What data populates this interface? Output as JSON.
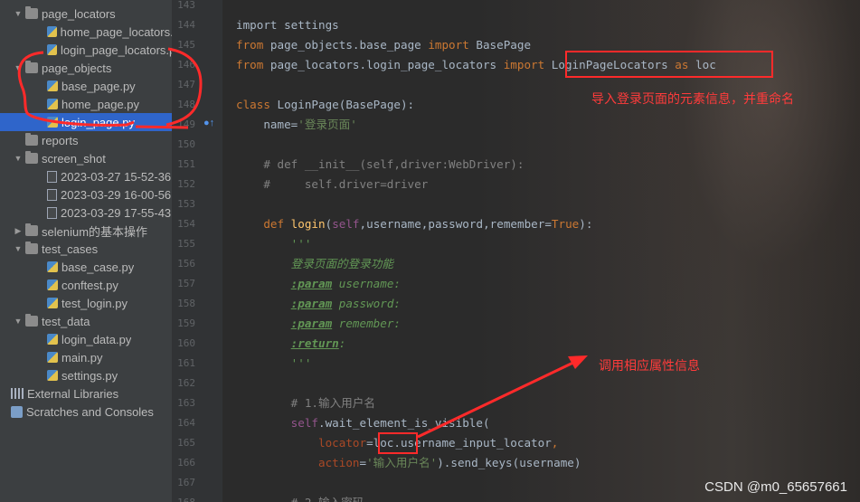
{
  "tree": [
    {
      "label": "page_locators",
      "type": "folder",
      "indent": 0,
      "open": true
    },
    {
      "label": "home_page_locators.py",
      "type": "py",
      "indent": 2
    },
    {
      "label": "login_page_locators.py",
      "type": "py",
      "indent": 2
    },
    {
      "label": "page_objects",
      "type": "folder",
      "indent": 0,
      "open": true
    },
    {
      "label": "base_page.py",
      "type": "py",
      "indent": 2
    },
    {
      "label": "home_page.py",
      "type": "py",
      "indent": 2
    },
    {
      "label": "login_page.py",
      "type": "py",
      "indent": 2,
      "selected": true
    },
    {
      "label": "reports",
      "type": "folder",
      "indent": 0,
      "open": false,
      "leaf": true
    },
    {
      "label": "screen_shot",
      "type": "folder",
      "indent": 0,
      "open": true
    },
    {
      "label": "2023-03-27 15-52-36",
      "type": "img",
      "indent": 2
    },
    {
      "label": "2023-03-29 16-00-56",
      "type": "img",
      "indent": 2
    },
    {
      "label": "2023-03-29 17-55-43",
      "type": "img",
      "indent": 2
    },
    {
      "label": "selenium的基本操作",
      "type": "folder",
      "indent": 0,
      "open": false
    },
    {
      "label": "test_cases",
      "type": "folder",
      "indent": 0,
      "open": true
    },
    {
      "label": "base_case.py",
      "type": "py",
      "indent": 2
    },
    {
      "label": "conftest.py",
      "type": "py",
      "indent": 2
    },
    {
      "label": "test_login.py",
      "type": "py",
      "indent": 2
    },
    {
      "label": "test_data",
      "type": "folder",
      "indent": 0,
      "open": true
    },
    {
      "label": "login_data.py",
      "type": "py",
      "indent": 2
    },
    {
      "label": "main.py",
      "type": "py",
      "indent": 1
    },
    {
      "label": "settings.py",
      "type": "py",
      "indent": 1
    },
    {
      "label": "External Libraries",
      "type": "lib",
      "indent": -1
    },
    {
      "label": "Scratches and Consoles",
      "type": "scratch",
      "indent": -1
    }
  ],
  "line_numbers": [
    "143",
    "144",
    "145",
    "146",
    "147",
    "148",
    "149",
    "150",
    "151",
    "152",
    "153",
    "154",
    "155",
    "156",
    "157",
    "158",
    "159",
    "160",
    "161",
    "162",
    "163",
    "164",
    "165",
    "166",
    "167",
    "168"
  ],
  "code": [
    [],
    [
      [
        "n",
        "import settings"
      ]
    ],
    [
      [
        "kw",
        "from "
      ],
      [
        "n",
        "page_objects.base_page "
      ],
      [
        "kw",
        "import "
      ],
      [
        "n",
        "BasePage"
      ]
    ],
    [
      [
        "kw",
        "from "
      ],
      [
        "n",
        "page_locators.login_page_locators "
      ],
      [
        "kw",
        "import "
      ],
      [
        "n",
        "LoginPageLocators "
      ],
      [
        "kw",
        "as "
      ],
      [
        "n",
        "loc"
      ]
    ],
    [],
    [
      [
        "kw",
        "class "
      ],
      [
        "n",
        "LoginPage(BasePage):"
      ]
    ],
    [
      [
        "n",
        "    name="
      ],
      [
        "str",
        "'登录页面'"
      ]
    ],
    [],
    [
      [
        "cm",
        "    # def __init__(self,driver:WebDriver):"
      ]
    ],
    [
      [
        "cm",
        "    #     self.driver=driver"
      ]
    ],
    [],
    [
      [
        "kw",
        "    def "
      ],
      [
        "fn",
        "login"
      ],
      [
        "n",
        "("
      ],
      [
        "slf",
        "self"
      ],
      [
        "n",
        ","
      ],
      [
        "n",
        "username"
      ],
      [
        "n",
        ","
      ],
      [
        "n",
        "password"
      ],
      [
        "n",
        ","
      ],
      [
        "n",
        "remember="
      ],
      [
        "kw",
        "True"
      ],
      [
        "n",
        "):"
      ]
    ],
    [
      [
        "doc",
        "        '''"
      ]
    ],
    [
      [
        "doc",
        "        登录页面的登录功能"
      ]
    ],
    [
      [
        "n",
        "        "
      ],
      [
        "tag",
        ":param"
      ],
      [
        "doc",
        " username:"
      ]
    ],
    [
      [
        "n",
        "        "
      ],
      [
        "tag",
        ":param"
      ],
      [
        "doc",
        " password:"
      ]
    ],
    [
      [
        "n",
        "        "
      ],
      [
        "tag",
        ":param"
      ],
      [
        "doc",
        " remember:"
      ]
    ],
    [
      [
        "n",
        "        "
      ],
      [
        "tag",
        ":return"
      ],
      [
        "doc",
        ":"
      ]
    ],
    [
      [
        "doc",
        "        '''"
      ]
    ],
    [],
    [
      [
        "cm",
        "        # 1.输入用户名"
      ]
    ],
    [
      [
        "slf",
        "        self"
      ],
      [
        "n",
        ".wait_element_is_visible("
      ]
    ],
    [
      [
        "prm",
        "            locator"
      ],
      [
        "n",
        "=loc.username_input_locator"
      ],
      [
        "kw",
        ","
      ]
    ],
    [
      [
        "prm",
        "            action"
      ],
      [
        "n",
        "="
      ],
      [
        "str",
        "'输入用户名'"
      ],
      [
        "n",
        ").send_keys(username)"
      ]
    ],
    [],
    [
      [
        "cm",
        "        # 2.输入密码"
      ]
    ]
  ],
  "annotations": {
    "import_note": "导入登录页面的元素信息，并重命名",
    "attr_note": "调用相应属性信息"
  },
  "watermark": "CSDN @m0_65657661",
  "colors": {
    "accent": "#ff2a2a",
    "selection": "#2f65ca",
    "keyword": "#cc7832",
    "string": "#6a8759"
  }
}
